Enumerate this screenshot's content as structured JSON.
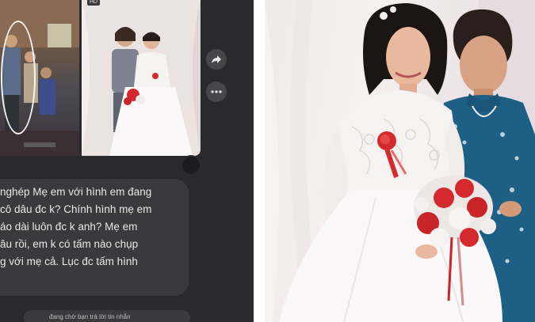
{
  "chat": {
    "badge": "HD",
    "message_lines": [
      "nghép Mẹ em với hình em đang",
      "cô dâu đc k? Chính hình mẹ em",
      "áo dài luôn đc k anh? Mẹ em",
      "âu rồi, em k có tấm nào chụp",
      "g với mẹ cả. Lục đc tấm hình"
    ],
    "typing_status": "đang chờ bạn trả lời tin nhắn"
  },
  "colors": {
    "chat_bg": "#2a2a2c",
    "bubble_bg": "#3a3a3c",
    "dress": "#f5f3f2",
    "ao_dai": "#1e5f86",
    "bouquet_red": "#d42a2e"
  },
  "icons": [
    "forward-icon",
    "more-icon",
    "reaction-icon"
  ]
}
